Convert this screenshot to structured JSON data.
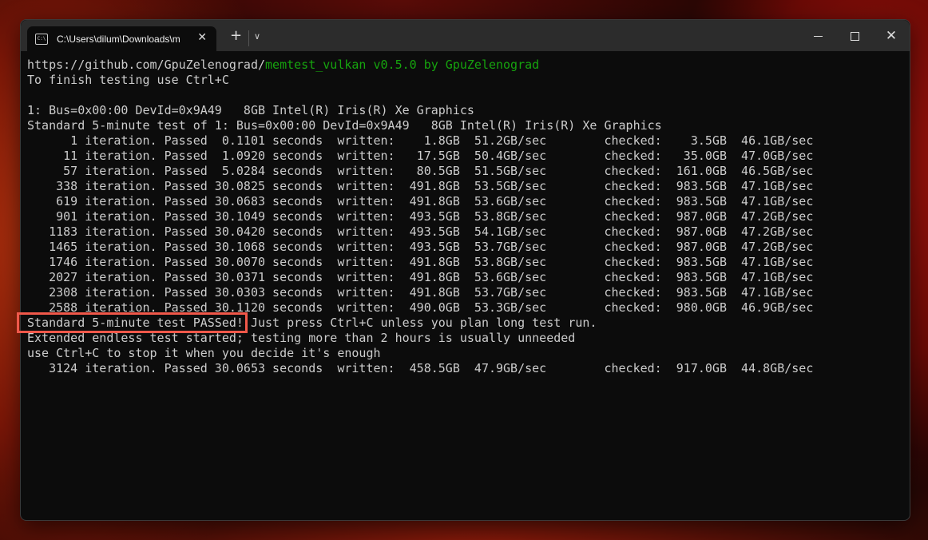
{
  "window": {
    "tab_title": "C:\\Users\\dilum\\Downloads\\m",
    "tab_icon": "terminal-icon",
    "new_tab": "+",
    "dropdown": "⌄",
    "close_tab": "✕",
    "close_window": "✕"
  },
  "colors": {
    "background": "#0c0c0c",
    "text": "#cccccc",
    "green": "#16a30e",
    "highlight": "#f0584a"
  },
  "terminal": {
    "header_url": "https://github.com/GpuZelenograd/",
    "header_app": "memtest_vulkan v0.5.0 by GpuZelenograd",
    "finish_hint": "To finish testing use Ctrl+C",
    "device_line": "1: Bus=0x00:00 DevId=0x9A49   8GB Intel(R) Iris(R) Xe Graphics",
    "standard_test_line": "Standard 5-minute test of 1: Bus=0x00:00 DevId=0x9A49   8GB Intel(R) Iris(R) Xe Graphics",
    "iterations": [
      "      1 iteration. Passed  0.1101 seconds  written:    1.8GB  51.2GB/sec        checked:    3.5GB  46.1GB/sec",
      "     11 iteration. Passed  1.0920 seconds  written:   17.5GB  50.4GB/sec        checked:   35.0GB  47.0GB/sec",
      "     57 iteration. Passed  5.0284 seconds  written:   80.5GB  51.5GB/sec        checked:  161.0GB  46.5GB/sec",
      "    338 iteration. Passed 30.0825 seconds  written:  491.8GB  53.5GB/sec        checked:  983.5GB  47.1GB/sec",
      "    619 iteration. Passed 30.0683 seconds  written:  491.8GB  53.6GB/sec        checked:  983.5GB  47.1GB/sec",
      "    901 iteration. Passed 30.1049 seconds  written:  493.5GB  53.8GB/sec        checked:  987.0GB  47.2GB/sec",
      "   1183 iteration. Passed 30.0420 seconds  written:  493.5GB  54.1GB/sec        checked:  987.0GB  47.2GB/sec",
      "   1465 iteration. Passed 30.1068 seconds  written:  493.5GB  53.7GB/sec        checked:  987.0GB  47.2GB/sec",
      "   1746 iteration. Passed 30.0070 seconds  written:  491.8GB  53.8GB/sec        checked:  983.5GB  47.1GB/sec",
      "   2027 iteration. Passed 30.0371 seconds  written:  491.8GB  53.6GB/sec        checked:  983.5GB  47.1GB/sec",
      "   2308 iteration. Passed 30.0303 seconds  written:  491.8GB  53.7GB/sec        checked:  983.5GB  47.1GB/sec",
      "   2588 iteration. Passed 30.1120 seconds  written:  490.0GB  53.3GB/sec        checked:  980.0GB  46.9GB/sec"
    ],
    "passed_text": "Standard 5-minute test PASSed!",
    "passed_rest": " Just press Ctrl+C unless you plan long test run.",
    "extended_line": "Extended endless test started; testing more than 2 hours is usually unneeded",
    "stop_hint": "use Ctrl+C to stop it when you decide it's enough",
    "extended_iteration": "   3124 iteration. Passed 30.0653 seconds  written:  458.5GB  47.9GB/sec        checked:  917.0GB  44.8GB/sec"
  }
}
